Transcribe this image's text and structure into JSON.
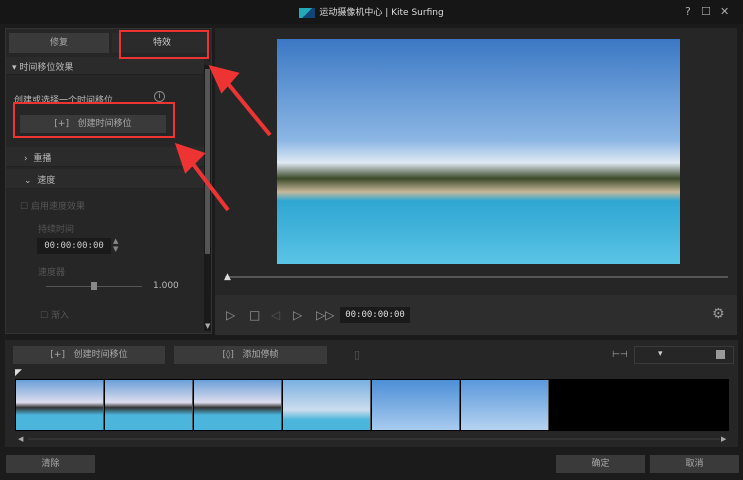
{
  "window": {
    "app_name": "运动摄像机中心",
    "separator": "|",
    "project": "Kite Surfing",
    "help": "?",
    "maximize": "☐",
    "close": "✕"
  },
  "tabs": [
    {
      "label": "修复"
    },
    {
      "label": "特效"
    }
  ],
  "panel": {
    "section_title": "时间移位效果",
    "hint": "创建或选择一个时间移位",
    "create_btn": "创建时间移位",
    "create_icon": "[+]",
    "replay": "重播",
    "speed": "速度",
    "enable_speed": "启用速度效果",
    "duration_label": "持续时间",
    "duration": "00:00:00:00",
    "speed_label": "速度器",
    "speed_value": "1.000",
    "speed_fraction": 0.5,
    "fade_in": "渐入"
  },
  "player": {
    "timecode": "00:00:00:00",
    "progress": 0
  },
  "timeline": {
    "create_btn": "创建时间移位",
    "freeze_btn": "添加停帧",
    "zoom_fraction": 0.1
  },
  "footer": {
    "clear": "清除",
    "ok": "确定",
    "cancel": "取消"
  },
  "colors": {
    "annotation": "#e33333"
  }
}
